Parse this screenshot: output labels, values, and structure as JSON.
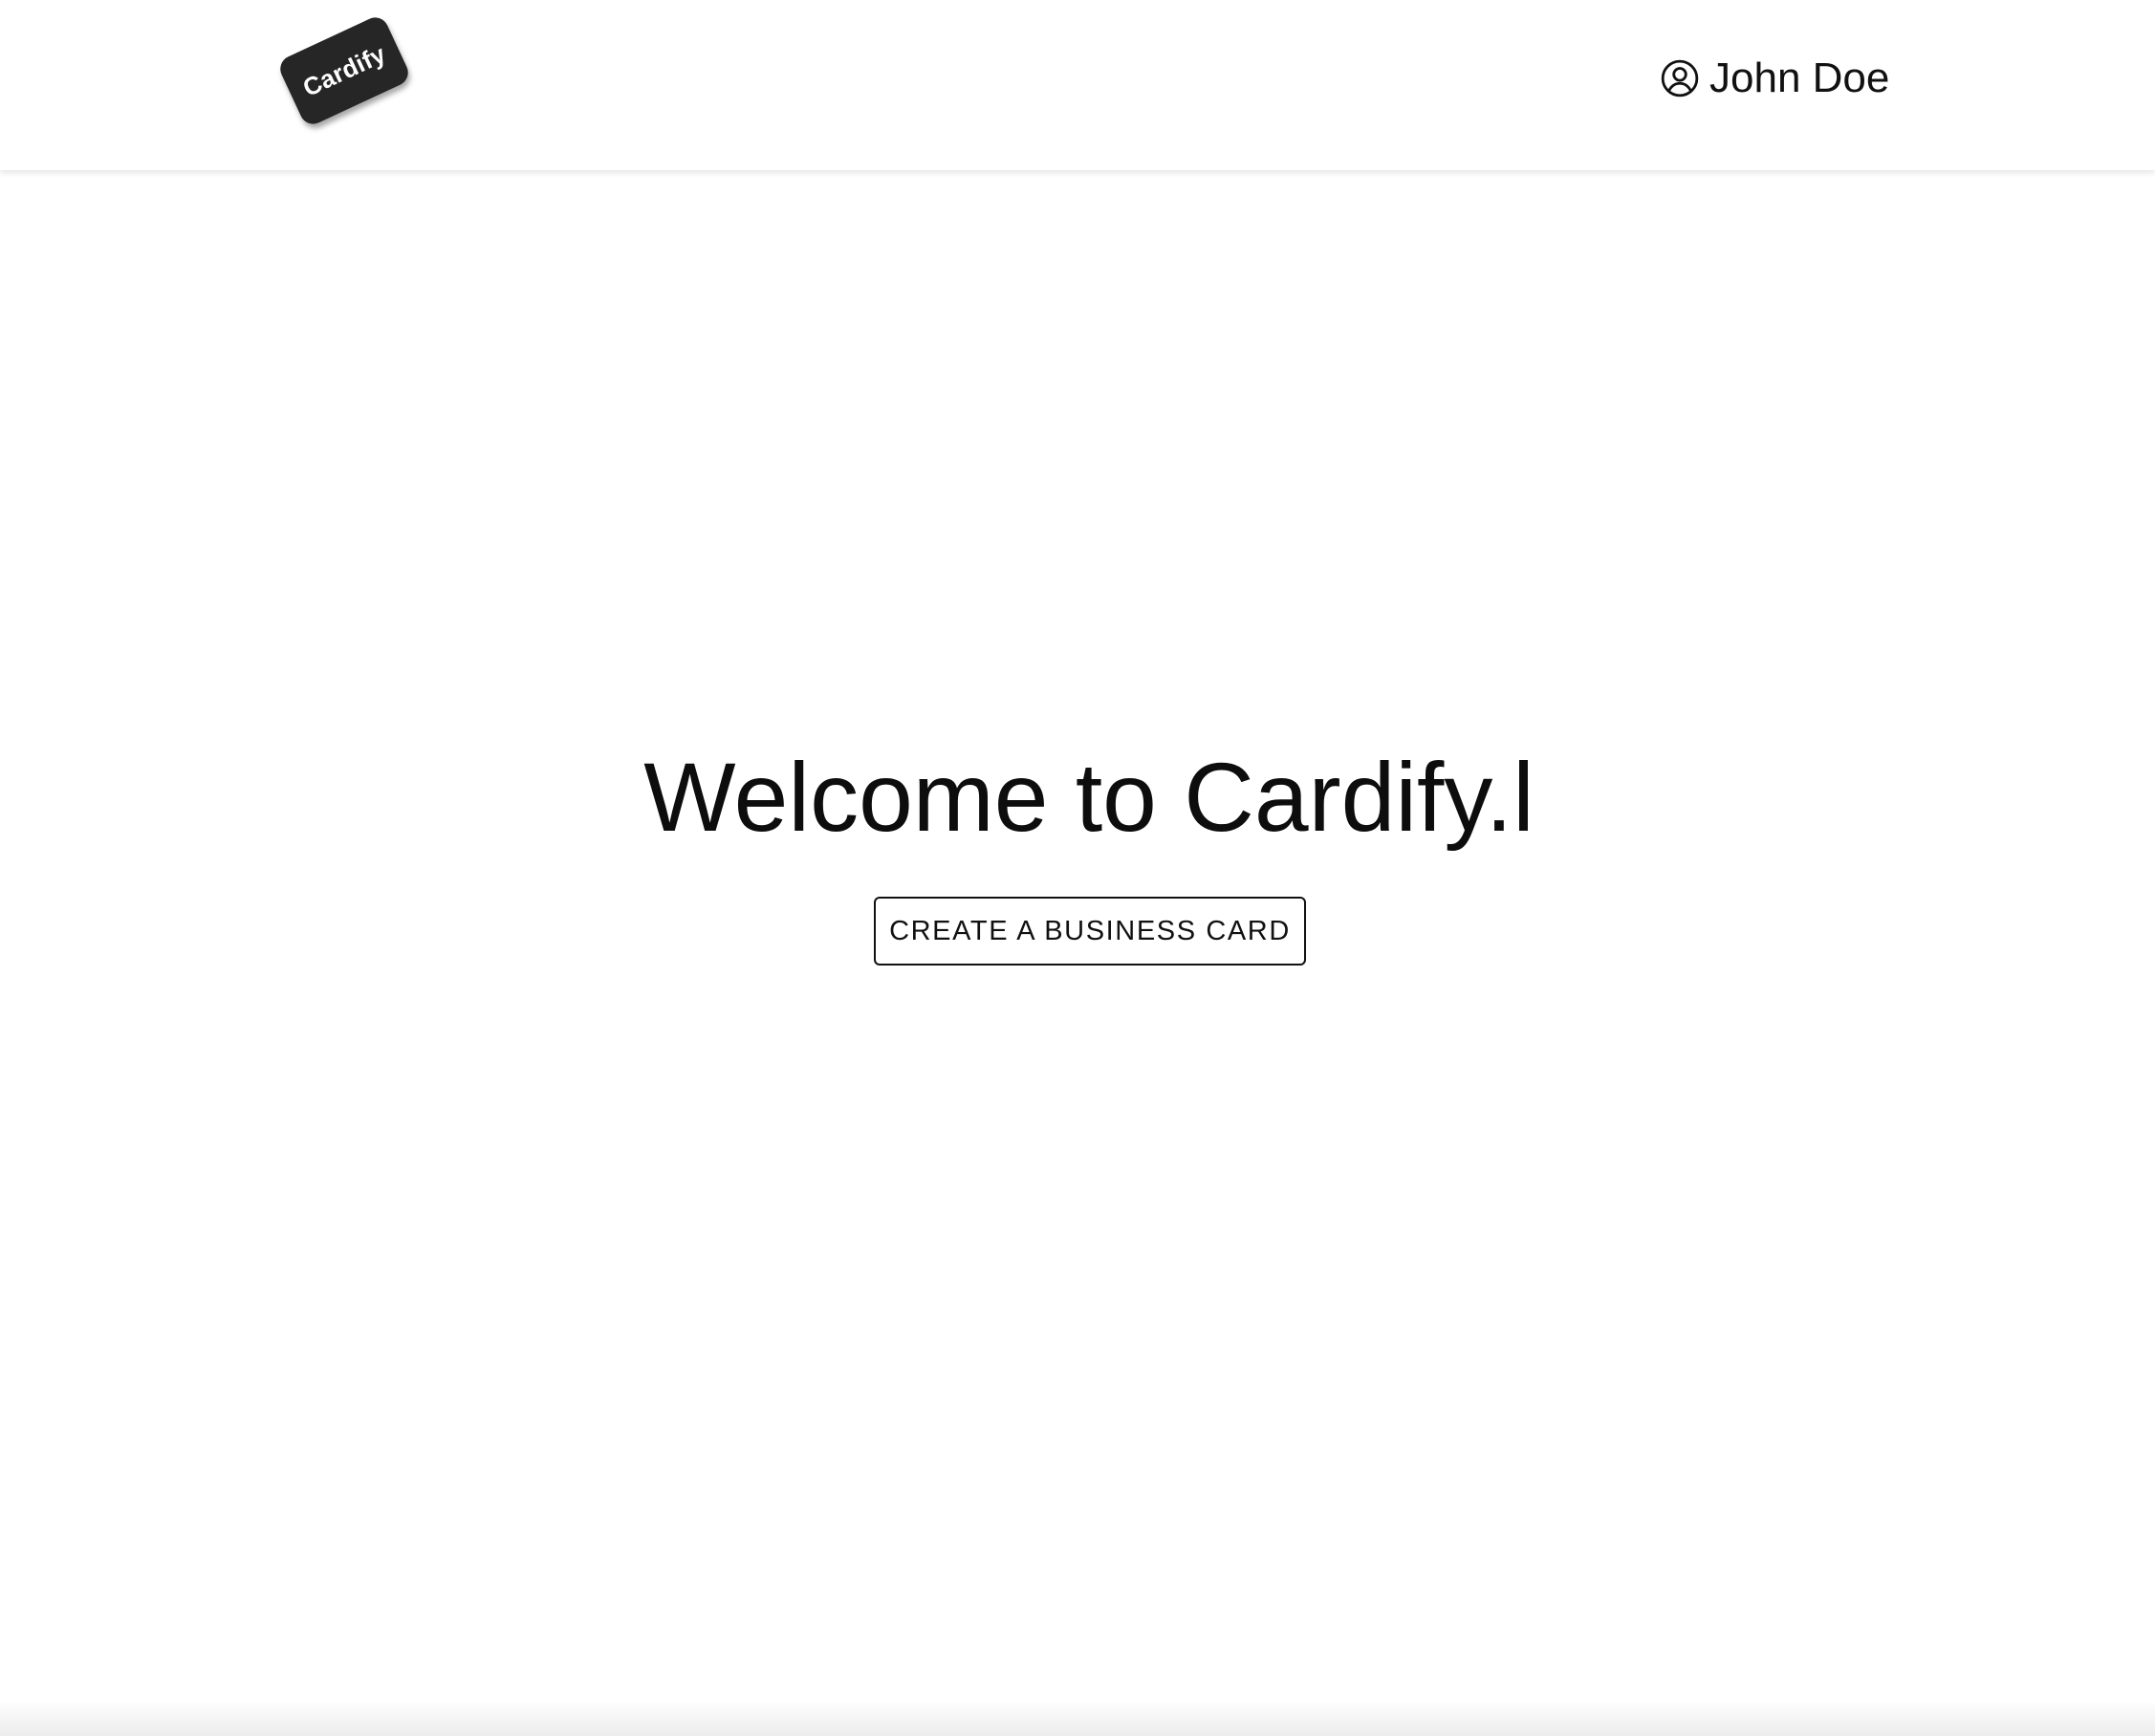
{
  "colors": {
    "background": "#ffffff",
    "text": "#111111",
    "logo_background": "#262626",
    "logo_text": "#ffffff"
  },
  "header": {
    "logo": {
      "text": "Cardify"
    },
    "user": {
      "icon": "user-circle-icon",
      "name": "John Doe"
    }
  },
  "main": {
    "headline": "Welcome to Cardify.l",
    "cta_label": "CREATE A BUSINESS CARD"
  }
}
